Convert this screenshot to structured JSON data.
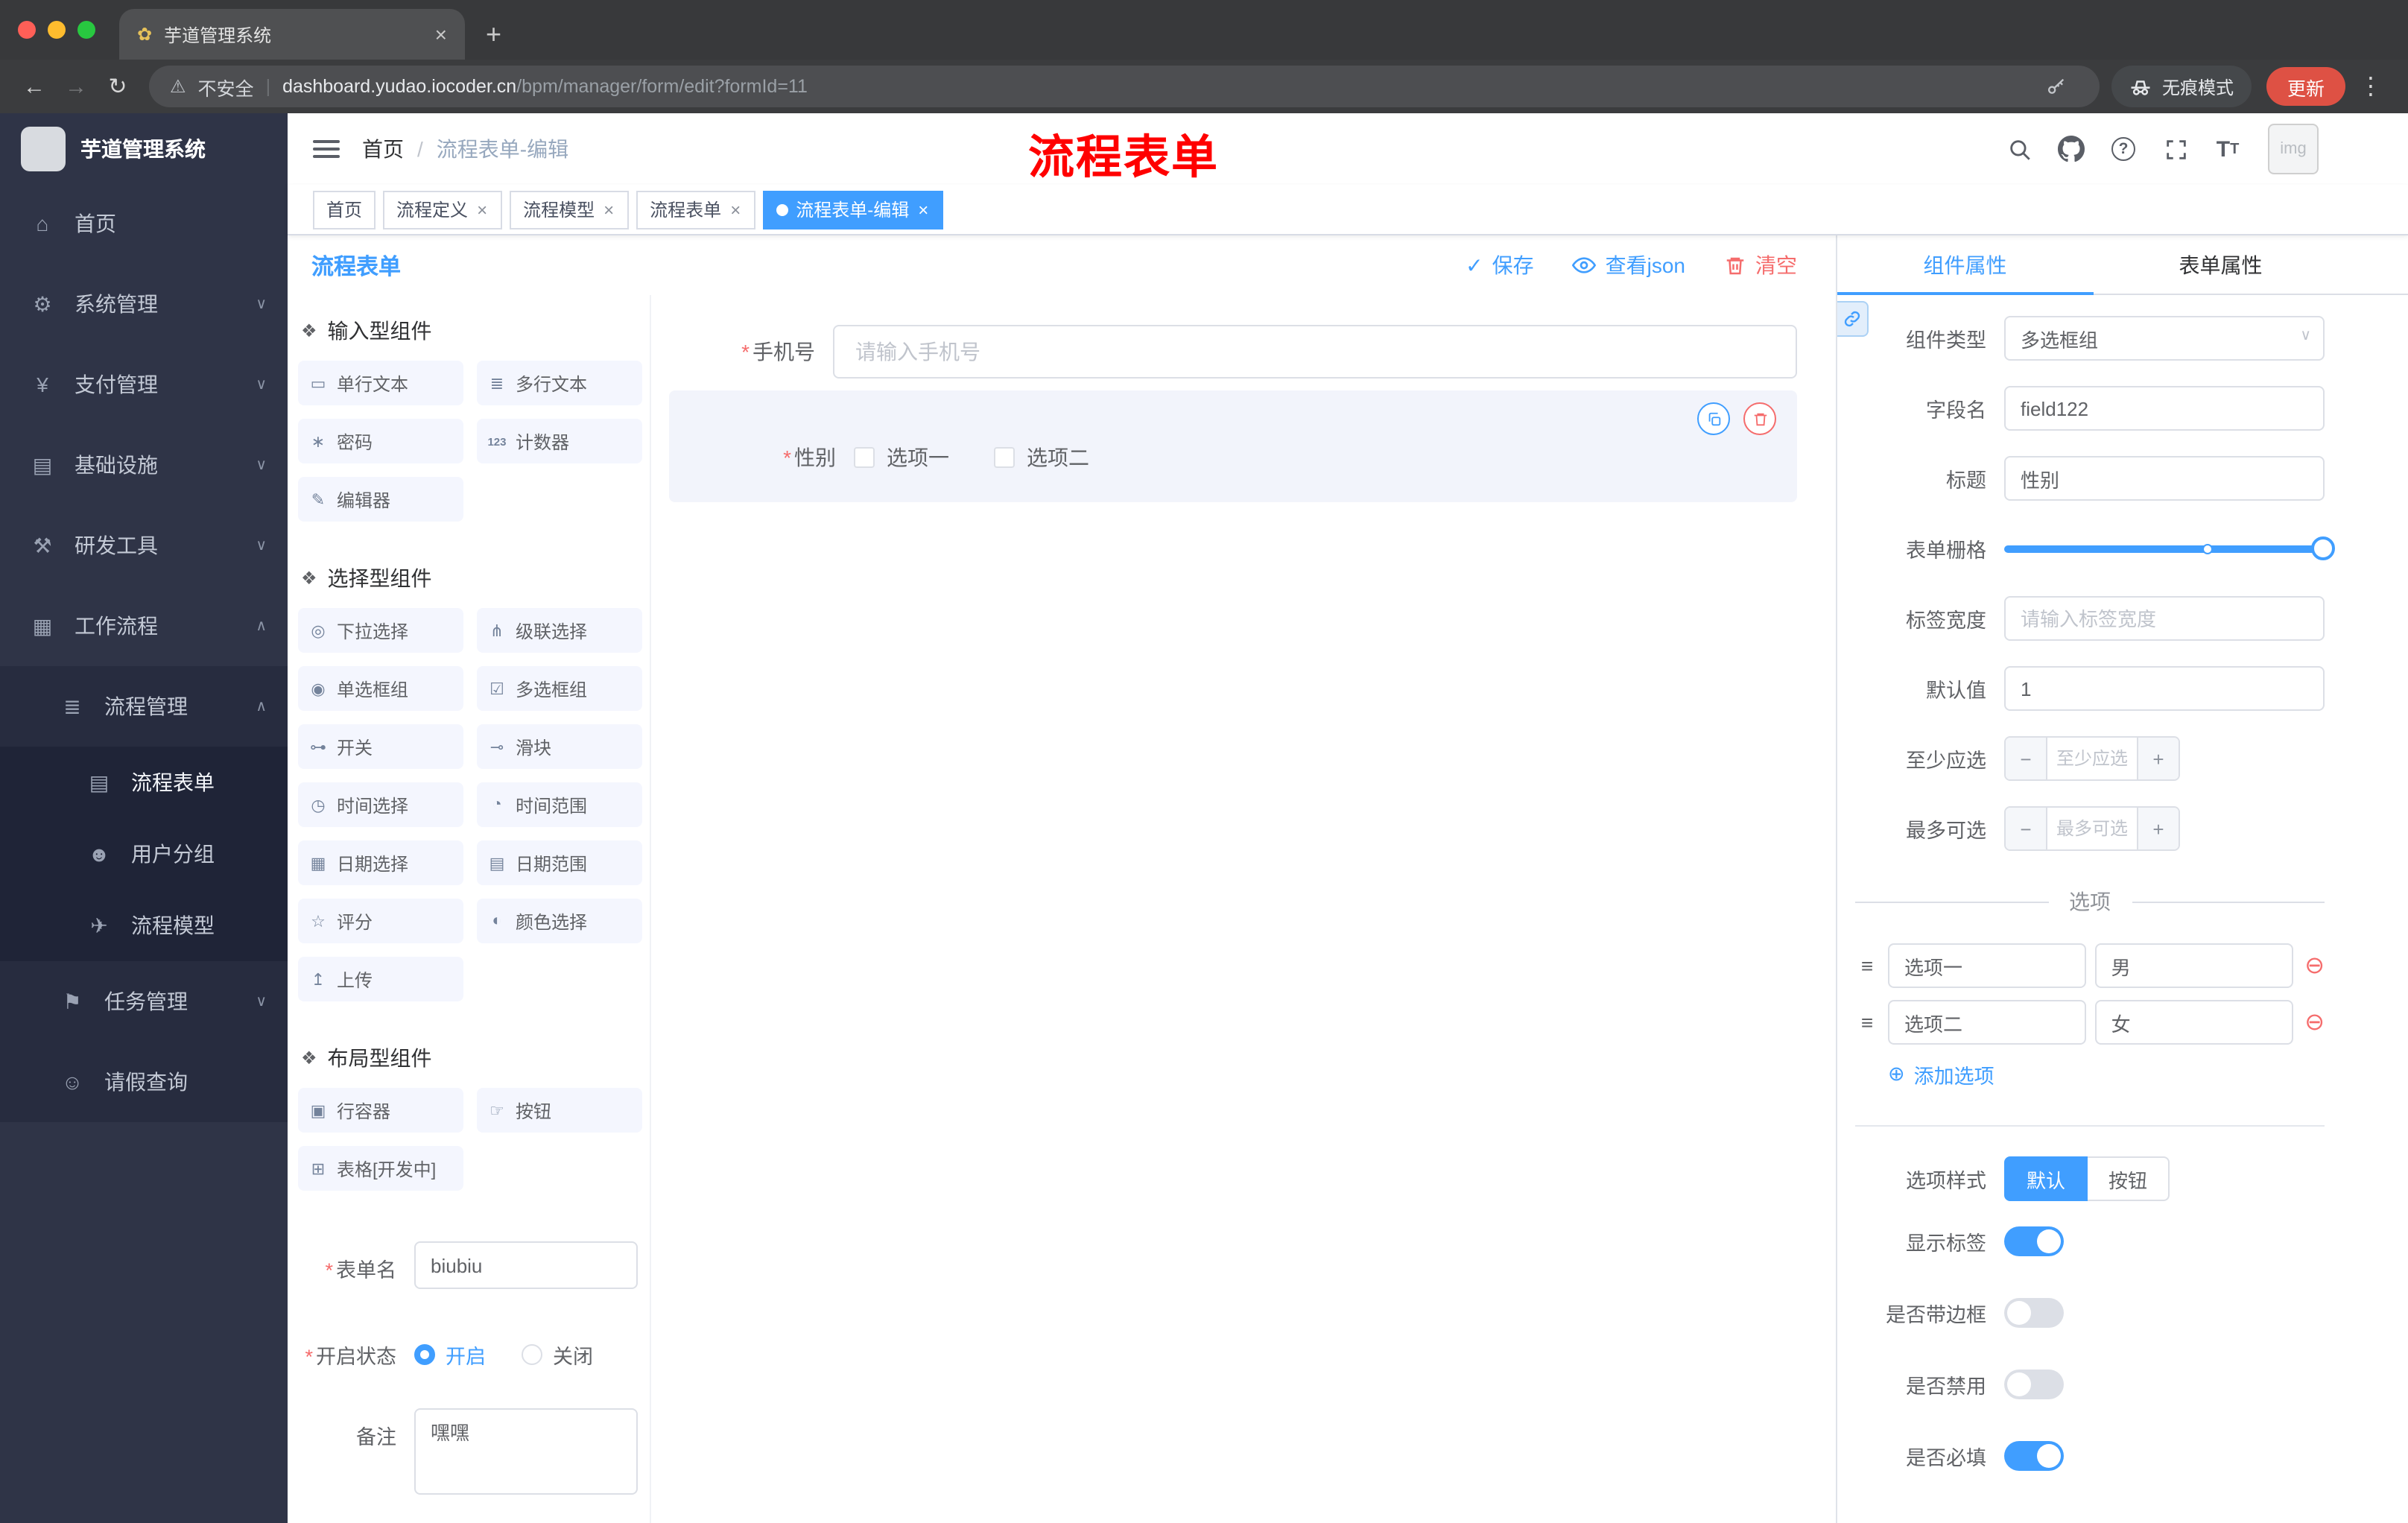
{
  "browser": {
    "tab_title": "芋道管理系统",
    "security_label": "不安全",
    "url_domain": "dashboard.yudao.iocoder.cn",
    "url_path": "/bpm/manager/form/edit?formId=11",
    "incognito_label": "无痕模式",
    "update_label": "更新"
  },
  "annotation_text": "流程表单",
  "colors": {
    "accent": "#409eff",
    "danger": "#f56c6c",
    "sidebar_bg": "#2f3447",
    "annotation": "#ff0000"
  },
  "icons": {
    "close": "×",
    "new_tab": "+",
    "back": "←",
    "forward": "→",
    "reload": "↻",
    "warning": "⚠",
    "divider": "|",
    "menu_dots": "⋮",
    "favicon": "✿",
    "chevron_down": "∨",
    "chevron_up": "∧",
    "breadcrumb_sep": "/",
    "check": "✓",
    "required": "*",
    "drag": "≡",
    "remove_circle": "⊖",
    "add_circle": "⊕",
    "select_caret": "∨",
    "section": "❖",
    "help": "?",
    "font_size_big": "T",
    "font_size_small": "T",
    "avatar_placeholder": "img"
  },
  "sidebar": {
    "logo_title": "芋道管理系统",
    "items": [
      {
        "label": "首页",
        "icon": "⌂"
      },
      {
        "label": "系统管理",
        "icon": "⚙"
      },
      {
        "label": "支付管理",
        "icon": "¥"
      },
      {
        "label": "基础设施",
        "icon": "▤"
      },
      {
        "label": "研发工具",
        "icon": "⚒"
      },
      {
        "label": "工作流程",
        "icon": "▦"
      },
      {
        "label": "流程管理",
        "icon": "≣"
      },
      {
        "label": "流程表单",
        "icon": "▤"
      },
      {
        "label": "用户分组",
        "icon": "☻"
      },
      {
        "label": "流程模型",
        "icon": "✈"
      },
      {
        "label": "任务管理",
        "icon": "⚑"
      },
      {
        "label": "请假查询",
        "icon": "☺"
      }
    ]
  },
  "breadcrumb": {
    "home": "首页",
    "current": "流程表单-编辑"
  },
  "tags": [
    {
      "label": "首页"
    },
    {
      "label": "流程定义"
    },
    {
      "label": "流程模型"
    },
    {
      "label": "流程表单"
    },
    {
      "label": "流程表单-编辑"
    }
  ],
  "designer": {
    "title": "流程表单",
    "save": "保存",
    "view_json": "查看json",
    "clear": "清空"
  },
  "components": {
    "sections": [
      {
        "title": "输入型组件",
        "items": [
          {
            "label": "单行文本",
            "icon": "▭"
          },
          {
            "label": "多行文本",
            "icon": "≣"
          },
          {
            "label": "密码",
            "icon": "∗"
          },
          {
            "label": "计数器",
            "icon": "123"
          },
          {
            "label": "编辑器",
            "icon": "✎"
          }
        ]
      },
      {
        "title": "选择型组件",
        "items": [
          {
            "label": "下拉选择",
            "icon": "◎"
          },
          {
            "label": "级联选择",
            "icon": "⋔"
          },
          {
            "label": "单选框组",
            "icon": "◉"
          },
          {
            "label": "多选框组",
            "icon": "☑"
          },
          {
            "label": "开关",
            "icon": "⊶"
          },
          {
            "label": "滑块",
            "icon": "⊸"
          },
          {
            "label": "时间选择",
            "icon": "◷"
          },
          {
            "label": "时间范围",
            "icon": "◔"
          },
          {
            "label": "日期选择",
            "icon": "▦"
          },
          {
            "label": "日期范围",
            "icon": "▤"
          },
          {
            "label": "评分",
            "icon": "☆"
          },
          {
            "label": "颜色选择",
            "icon": "◐"
          },
          {
            "label": "上传",
            "icon": "↥"
          }
        ]
      },
      {
        "title": "布局型组件",
        "items": [
          {
            "label": "行容器",
            "icon": "▣"
          },
          {
            "label": "按钮",
            "icon": "☞"
          },
          {
            "label": "表格[开发中]",
            "icon": "⊞"
          }
        ]
      }
    ]
  },
  "form_meta": {
    "name_label": "表单名",
    "name_value": "biubiu",
    "status_label": "开启状态",
    "status_on": "开启",
    "status_off": "关闭",
    "remark_label": "备注",
    "remark_value": "嘿嘿"
  },
  "canvas": {
    "phone_label": "手机号",
    "phone_placeholder": "请输入手机号",
    "gender_label": "性别",
    "gender_opt1": "选项一",
    "gender_opt2": "选项二"
  },
  "props": {
    "tab_component": "组件属性",
    "tab_form": "表单属性",
    "rows": {
      "component_type": {
        "label": "组件类型",
        "value": "多选框组"
      },
      "field_name": {
        "label": "字段名",
        "value": "field122"
      },
      "title": {
        "label": "标题",
        "value": "性别"
      },
      "grid": {
        "label": "表单栅格"
      },
      "label_width": {
        "label": "标签宽度",
        "placeholder": "请输入标签宽度"
      },
      "default": {
        "label": "默认值",
        "value": "1"
      },
      "min": {
        "label": "至少应选",
        "placeholder": "至少应选"
      },
      "max": {
        "label": "最多可选",
        "placeholder": "最多可选"
      }
    },
    "options_title": "选项",
    "options": [
      {
        "label": "选项一",
        "value": "男"
      },
      {
        "label": "选项二",
        "value": "女"
      }
    ],
    "add_option": "添加选项",
    "style": {
      "label": "选项样式",
      "default": "默认",
      "button": "按钮"
    },
    "toggles": [
      {
        "label": "显示标签",
        "on": true
      },
      {
        "label": "是否带边框",
        "on": false
      },
      {
        "label": "是否禁用",
        "on": false
      },
      {
        "label": "是否必填",
        "on": true
      }
    ]
  }
}
